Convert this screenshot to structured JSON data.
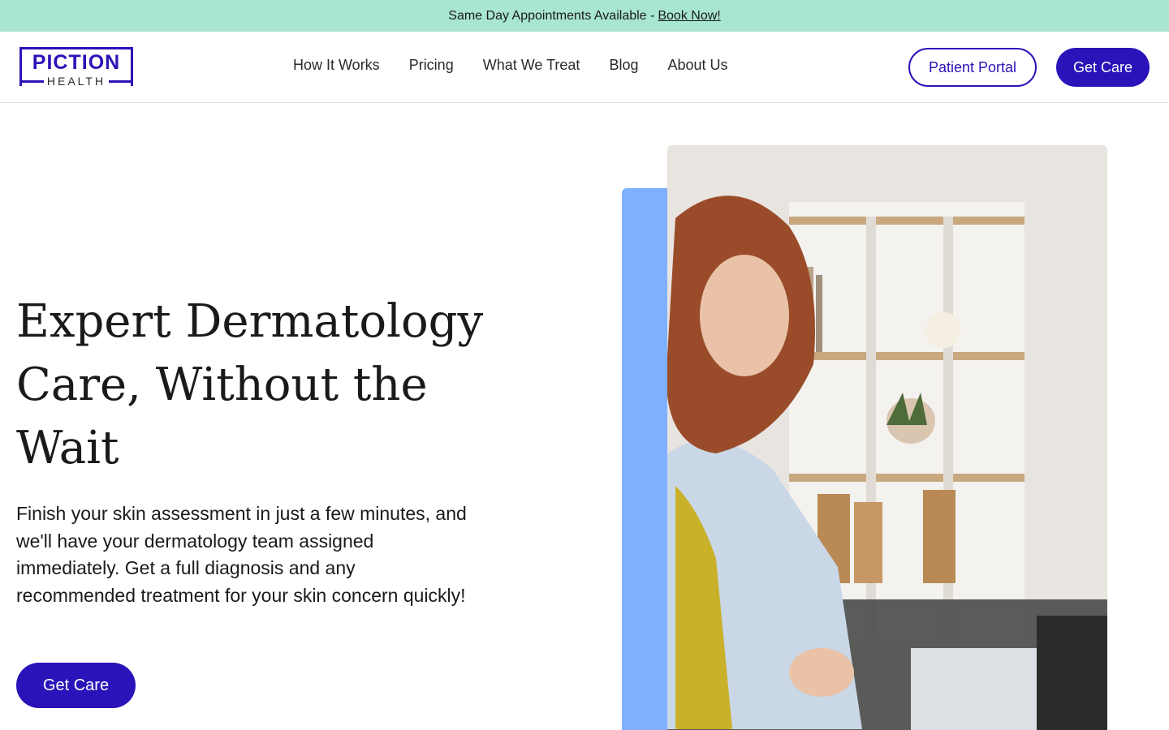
{
  "announcement": {
    "text": "Same Day Appointments Available -",
    "link": "Book Now!"
  },
  "logo": {
    "line1": "PICTION",
    "line2": "HEALTH"
  },
  "nav": {
    "items": [
      "How It Works",
      "Pricing",
      "What We Treat",
      "Blog",
      "About Us"
    ]
  },
  "header_actions": {
    "patient_portal": "Patient Portal",
    "get_care": "Get Care"
  },
  "hero": {
    "title": "Expert Dermatology Care, Without the Wait",
    "body": "Finish your skin assessment in just a few minutes, and we'll have your dermatology team assigned immediately. Get a full diagnosis and any recommended treatment for your skin concern quickly!",
    "cta": "Get Care"
  },
  "colors": {
    "brand": "#2a13b8",
    "announcement_bg": "#a8e6cf",
    "accent_block": "#7fb0ff"
  }
}
